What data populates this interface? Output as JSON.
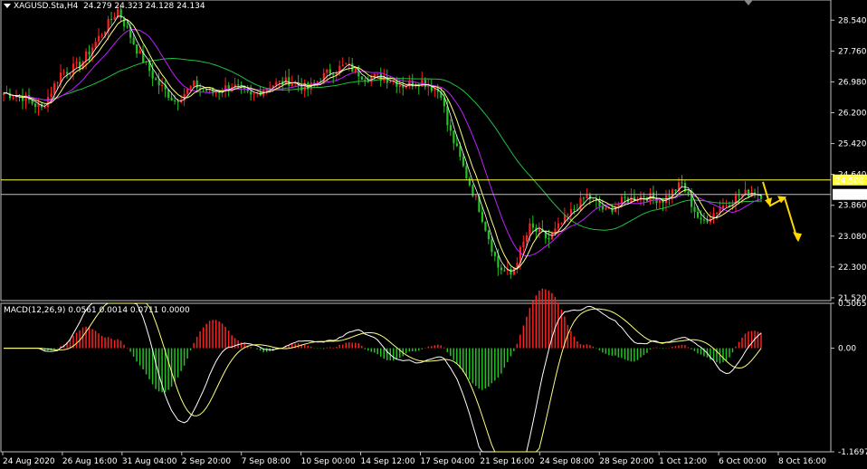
{
  "header": {
    "symbol": "XAGUSD.Sta,H4",
    "ohlc": "24.279 24.323 24.128 24.134"
  },
  "macd_header": "MACD(12,26,9) 0.0561 0.0014 0.0711 0.0000",
  "colors": {
    "background": "#000000",
    "bull": "#ff2020",
    "bear": "#22c322",
    "ma_fast": "#ffff80",
    "ma_mid": "#c020ff",
    "ma_slow": "#20c040",
    "ma_white": "#ffffff",
    "level_line": "#ffff40",
    "arrow": "#ffd700",
    "grid_axis": "#c0c0c0"
  },
  "chart_data": [
    {
      "type": "candlestick",
      "title": "XAGUSD.Sta,H4",
      "y_ticks": [
        "28.540",
        "27.760",
        "26.980",
        "26.200",
        "25.420",
        "24.640",
        "23.860",
        "23.080",
        "22.300",
        "21.520"
      ],
      "ylim": [
        21.45,
        29.05
      ],
      "x_tick_labels": [
        "24 Aug 2020",
        "26 Aug 16:00",
        "31 Aug 04:00",
        "2 Sep 20:00",
        "7 Sep 08:00",
        "10 Sep 00:00",
        "14 Sep 12:00",
        "17 Sep 04:00",
        "21 Sep 16:00",
        "24 Sep 08:00",
        "28 Sep 20:00",
        "1 Oct 12:00",
        "6 Oct 00:00",
        "8 Oct 16:00"
      ],
      "price_keypoints": [
        [
          0,
          26.7
        ],
        [
          6,
          26.6
        ],
        [
          12,
          26.3
        ],
        [
          18,
          27.2
        ],
        [
          24,
          27.4
        ],
        [
          30,
          28.1
        ],
        [
          36,
          28.8
        ],
        [
          42,
          27.8
        ],
        [
          48,
          27.0
        ],
        [
          54,
          26.5
        ],
        [
          60,
          26.9
        ],
        [
          66,
          26.7
        ],
        [
          72,
          26.9
        ],
        [
          78,
          26.6
        ],
        [
          84,
          26.9
        ],
        [
          90,
          27.0
        ],
        [
          96,
          26.8
        ],
        [
          102,
          27.2
        ],
        [
          108,
          27.4
        ],
        [
          114,
          27.1
        ],
        [
          120,
          27.1
        ],
        [
          126,
          26.9
        ],
        [
          132,
          27.0
        ],
        [
          138,
          26.7
        ],
        [
          140,
          25.9
        ],
        [
          146,
          24.6
        ],
        [
          150,
          23.8
        ],
        [
          156,
          22.3
        ],
        [
          160,
          22.1
        ],
        [
          166,
          23.3
        ],
        [
          172,
          23.0
        ],
        [
          178,
          23.6
        ],
        [
          184,
          24.1
        ],
        [
          190,
          23.7
        ],
        [
          196,
          24.0
        ],
        [
          202,
          24.1
        ],
        [
          208,
          24.0
        ],
        [
          214,
          24.4
        ],
        [
          220,
          23.4
        ],
        [
          226,
          23.8
        ],
        [
          232,
          24.1
        ],
        [
          236,
          24.2
        ],
        [
          239,
          24.134
        ]
      ],
      "levels": [
        {
          "label": "24.500",
          "value": 24.5
        },
        {
          "label": "24.134",
          "value": 24.134
        }
      ],
      "overlays": [
        "MA fast",
        "MA mid",
        "MA slow"
      ]
    },
    {
      "type": "bar",
      "title": "MACD(12,26,9) 0.0561 0.0014 0.0711 0.0000",
      "y_ticks": [
        "0.5065",
        "0.00",
        "-1.1697"
      ],
      "ylim": [
        -1.1697,
        0.5065
      ],
      "note_series": [
        "histogram",
        "MACD",
        "signal"
      ]
    }
  ]
}
